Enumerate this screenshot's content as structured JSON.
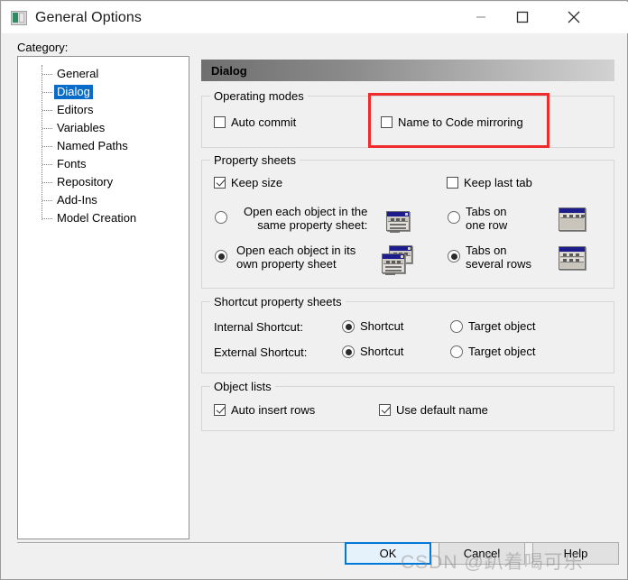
{
  "window": {
    "title": "General Options",
    "icon": "application-window-icon",
    "controls": {
      "minimize": "minimize-icon",
      "maximize": "maximize-icon",
      "close": "close-icon"
    }
  },
  "category": {
    "label": "Category:",
    "items": [
      {
        "label": "General",
        "selected": false
      },
      {
        "label": "Dialog",
        "selected": true
      },
      {
        "label": "Editors",
        "selected": false
      },
      {
        "label": "Variables",
        "selected": false
      },
      {
        "label": "Named Paths",
        "selected": false
      },
      {
        "label": "Fonts",
        "selected": false
      },
      {
        "label": "Repository",
        "selected": false
      },
      {
        "label": "Add-Ins",
        "selected": false
      },
      {
        "label": "Model Creation",
        "selected": false
      }
    ]
  },
  "pane": {
    "header": "Dialog",
    "operating_modes": {
      "title": "Operating modes",
      "auto_commit": {
        "label": "Auto commit",
        "checked": false
      },
      "name_to_code_mirroring": {
        "label": "Name to Code mirroring",
        "checked": false
      }
    },
    "property_sheets": {
      "title": "Property sheets",
      "keep_size": {
        "label": "Keep size",
        "checked": true
      },
      "keep_last_tab": {
        "label": "Keep last tab",
        "checked": false
      },
      "open_same_sheet": {
        "label": "Open each object in the\nsame property sheet:",
        "checked": false,
        "icon": "single-property-sheet-icon"
      },
      "open_own_sheet": {
        "label": "Open each object in its\nown property sheet",
        "checked": true,
        "icon": "stacked-property-sheets-icon"
      },
      "tabs_one_row": {
        "label": "Tabs on\none row",
        "checked": false,
        "icon": "tabs-one-row-icon"
      },
      "tabs_several_rows": {
        "label": "Tabs on\nseveral rows",
        "checked": true,
        "icon": "tabs-several-rows-icon"
      }
    },
    "shortcut_property_sheets": {
      "title": "Shortcut property sheets",
      "internal_label": "Internal Shortcut:",
      "external_label": "External Shortcut:",
      "internal_shortcut": {
        "label": "Shortcut",
        "checked": true
      },
      "internal_target": {
        "label": "Target object",
        "checked": false
      },
      "external_shortcut": {
        "label": "Shortcut",
        "checked": true
      },
      "external_target": {
        "label": "Target object",
        "checked": false
      }
    },
    "object_lists": {
      "title": "Object lists",
      "auto_insert_rows": {
        "label": "Auto insert rows",
        "checked": true
      },
      "use_default_name": {
        "label": "Use default name",
        "checked": true
      }
    }
  },
  "footer": {
    "ok": "OK",
    "cancel": "Cancel",
    "help": "Help"
  },
  "watermark": "CSDN @趴着喝可乐",
  "colors": {
    "accent": "#0a6cc9",
    "highlight": "#ef2b2b",
    "face": "#f0f0f0",
    "ok_border": "#0078d7"
  }
}
